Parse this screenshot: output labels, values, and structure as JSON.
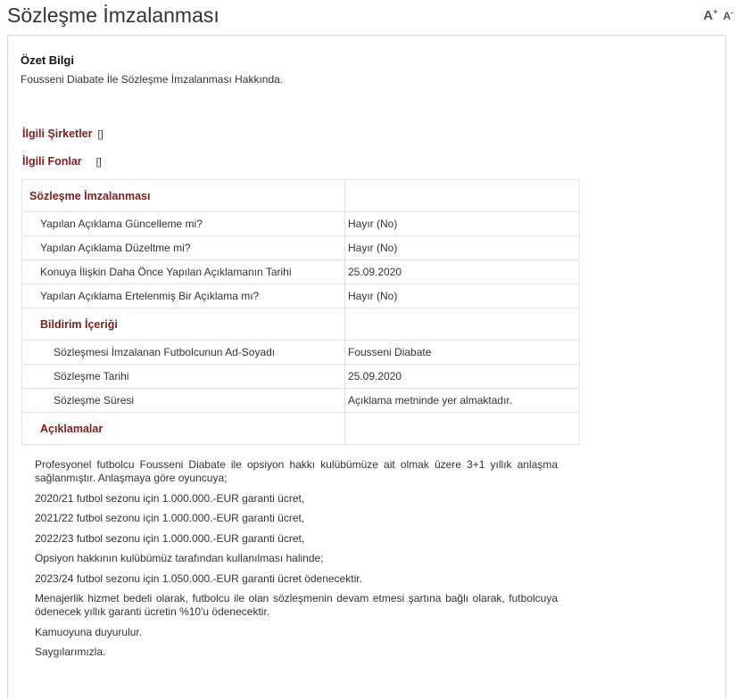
{
  "page": {
    "title": "Sözleşme İmzalanması",
    "font_increase": "A",
    "font_increase_mark": "+",
    "font_decrease": "A",
    "font_decrease_mark": "-"
  },
  "summary": {
    "heading": "Özet Bilgi",
    "text": "Fousseni Diabate İle Sözleşme İmzalanması Hakkında."
  },
  "related": {
    "companies_label": "İlgili Şirketler",
    "companies_value": "[]",
    "funds_label": "İlgili Fonlar",
    "funds_value": "[]"
  },
  "table": {
    "section_title": "Sözleşme İmzalanması",
    "rows": [
      {
        "label": "Yapılan Açıklama Güncelleme mi?",
        "value": "Hayır (No)"
      },
      {
        "label": "Yapılan Açıklama Düzeltme mi?",
        "value": "Hayır (No)"
      },
      {
        "label": "Konuya İlişkin Daha Önce Yapılan Açıklamanın Tarihi",
        "value": "25.09.2020"
      },
      {
        "label": "Yapılan Açıklama Ertelenmiş Bir Açıklama mı?",
        "value": "Hayır (No)"
      }
    ],
    "notification_title": "Bildirim İçeriği",
    "notification_rows": [
      {
        "label": "Sözleşmesi İmzalanan Futbolcunun Ad-Soyadı",
        "value": "Fousseni Diabate"
      },
      {
        "label": "Sözleşme Tarihi",
        "value": "25.09.2020"
      },
      {
        "label": "Sözleşme Süresi",
        "value": "Açıklama metninde yer almaktadır."
      }
    ],
    "explanations_title": "Açıklamalar"
  },
  "description": [
    "Profesyonel futbolcu Fousseni Diabate ile opsiyon hakkı kulübümüze ait olmak üzere 3+1 yıllık anlaşma sağlanmıştır. Anlaşmaya göre oyuncuya;",
    "2020/21 futbol sezonu için 1.000.000.-EUR garanti ücret,",
    "2021/22 futbol sezonu için 1.000.000.-EUR garanti ücret,",
    "2022/23 futbol sezonu için 1.000.000.-EUR garanti ücret,",
    "Opsiyon hakkının kulübümüz tarafından kullanılması halinde;",
    "2023/24 futbol sezonu için 1.050.000.-EUR garanti ücret ödenecektir.",
    "Menajerlik hizmet bedeli olarak, futbolcu ile olan sözleşmenin devam etmesi şartına bağlı olarak, futbolcuya ödenecek yıllık garanti ücretin %10'u ödenecektir.",
    "Kamuoyuna duyurulur.",
    "Saygılarımızla."
  ]
}
